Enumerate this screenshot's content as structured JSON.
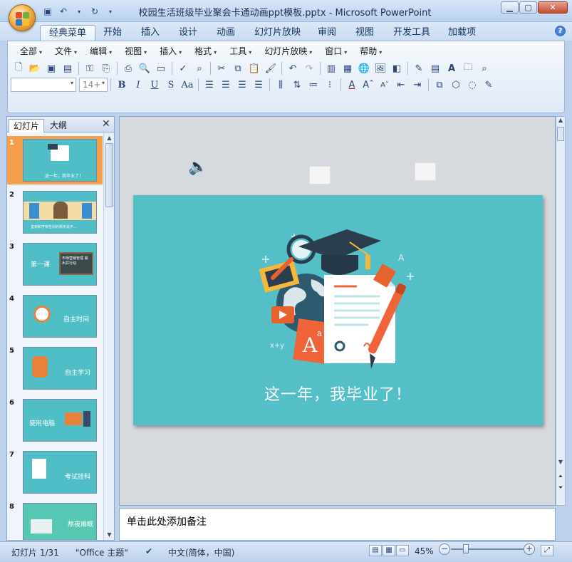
{
  "window": {
    "title": "校园生活班级毕业聚会卡通动画ppt模板.pptx - Microsoft PowerPoint"
  },
  "quick_access": {
    "icons": [
      "save-icon",
      "undo-icon",
      "redo-icon"
    ]
  },
  "ribbon_tabs": [
    "经典菜单",
    "开始",
    "插入",
    "设计",
    "动画",
    "幻灯片放映",
    "审阅",
    "视图",
    "开发工具",
    "加载项"
  ],
  "help_label": "?",
  "menus": [
    "全部",
    "文件",
    "编辑",
    "视图",
    "插入",
    "格式",
    "工具",
    "幻灯片放映",
    "窗口",
    "帮助"
  ],
  "font_size": "14+",
  "left_pane": {
    "tabs": [
      "幻灯片",
      "大纲"
    ],
    "close": "✕"
  },
  "thumbnails": [
    {
      "num": "1",
      "text": "这一年，我毕业了！",
      "bg": "#4fbec6"
    },
    {
      "num": "2",
      "text": "直到和学校告别的那天说不...",
      "bg": "#4fbec6"
    },
    {
      "num": "3",
      "text": "第一课",
      "extra": "市场营销管理 输出并行动",
      "bg": "#4fbec6"
    },
    {
      "num": "4",
      "text": "自主时间",
      "bg": "#4fbec6"
    },
    {
      "num": "5",
      "text": "自主学习",
      "bg": "#4fbec6"
    },
    {
      "num": "6",
      "text": "使用电脑",
      "bg": "#4fbec6"
    },
    {
      "num": "7",
      "text": "考试挂科",
      "bg": "#4fbec6"
    },
    {
      "num": "8",
      "text": "熬夜难眠",
      "bg": "#4fbec6"
    }
  ],
  "slide": {
    "title": "这一年，我毕业了！",
    "bg": "#55bfc8"
  },
  "notes_placeholder": "单击此处添加备注",
  "status": {
    "slide_info": "幻灯片 1/31",
    "theme": "\"Office 主题\"",
    "language": "中文(简体，中国)",
    "zoom": "45%"
  }
}
